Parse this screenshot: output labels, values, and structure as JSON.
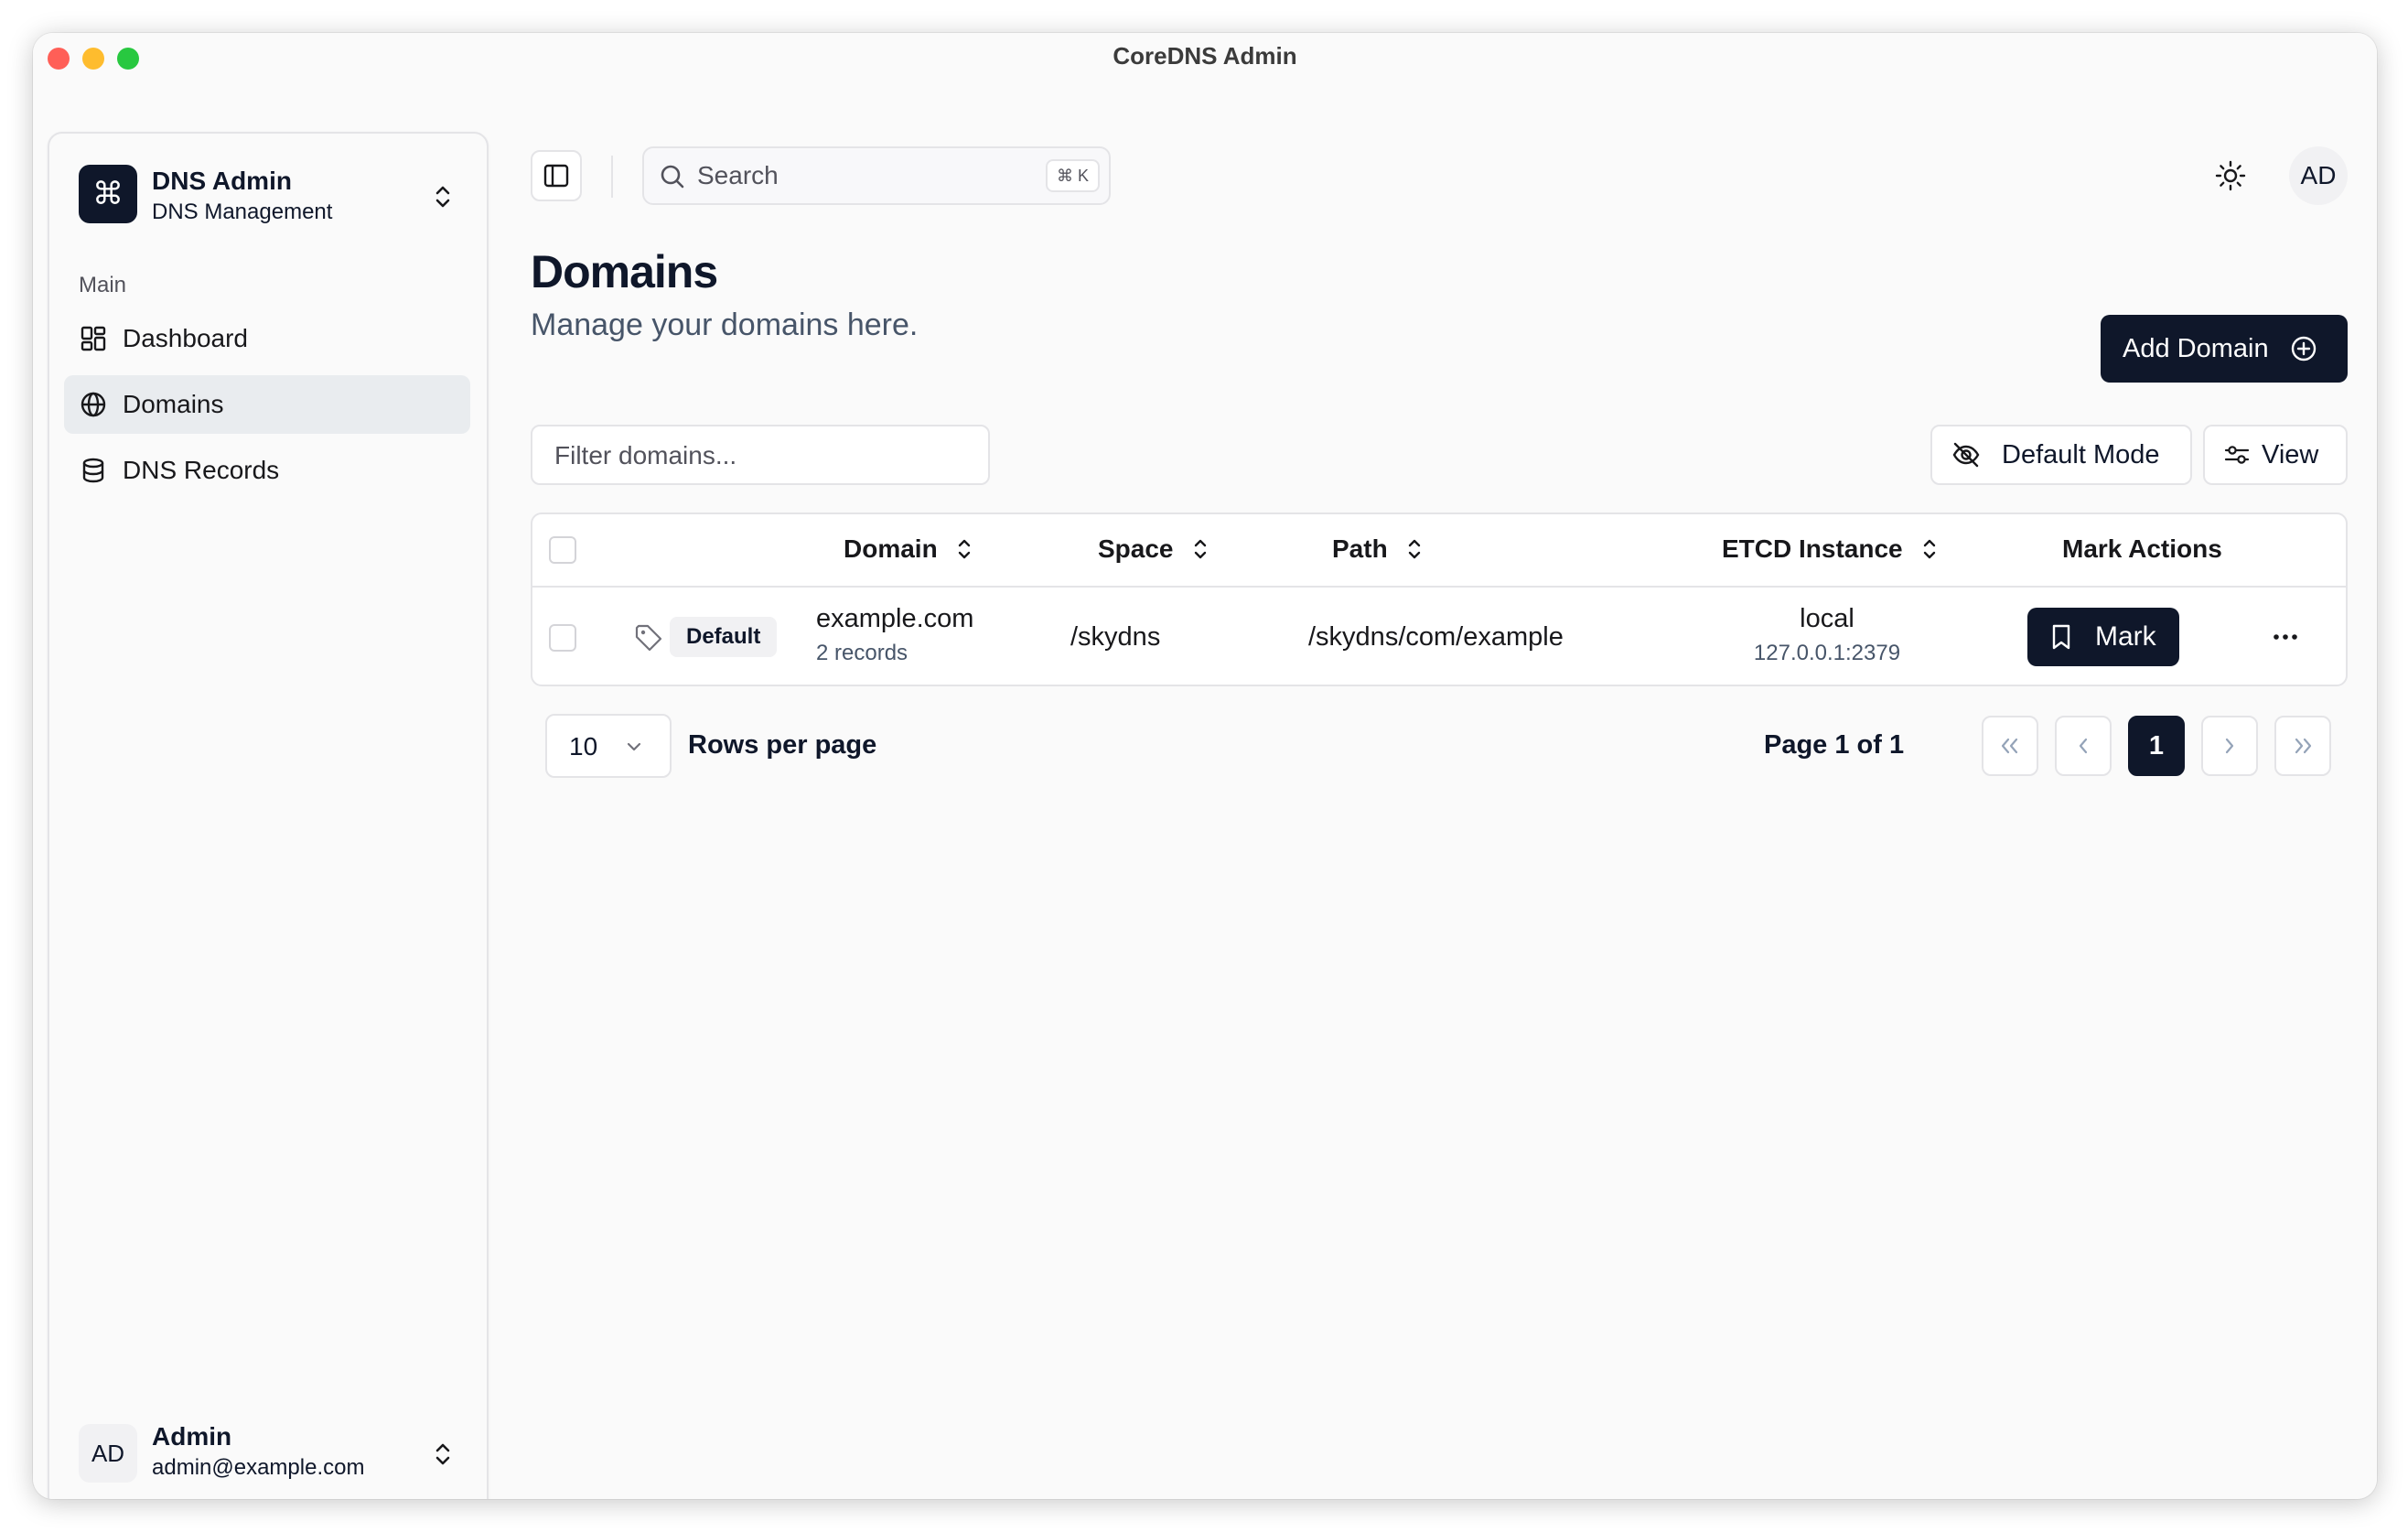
{
  "window": {
    "title": "CoreDNS Admin"
  },
  "sidebar": {
    "brand_name": "DNS Admin",
    "brand_subtitle": "DNS Management",
    "section_label": "Main",
    "items": [
      {
        "label": "Dashboard",
        "icon": "dashboard-icon",
        "active": false
      },
      {
        "label": "Domains",
        "icon": "globe-icon",
        "active": true
      },
      {
        "label": "DNS Records",
        "icon": "database-icon",
        "active": false
      }
    ],
    "user": {
      "initials": "AD",
      "name": "Admin",
      "email": "admin@example.com"
    }
  },
  "header": {
    "search_label": "Search",
    "search_shortcut": "⌘ K",
    "avatar_initials": "AD"
  },
  "page": {
    "title": "Domains",
    "subtitle": "Manage your domains here.",
    "add_button": "Add Domain",
    "filter_placeholder": "Filter domains...",
    "mode_button": "Default Mode",
    "view_button": "View"
  },
  "table": {
    "columns": [
      "Domain",
      "Space",
      "Path",
      "ETCD Instance",
      "Mark Actions"
    ],
    "rows": [
      {
        "tag": "Default",
        "domain": "example.com",
        "records": "2 records",
        "space": "/skydns",
        "path": "/skydns/com/example",
        "instance": "local",
        "instance_address": "127.0.0.1:2379",
        "mark_label": "Mark"
      }
    ]
  },
  "pagination": {
    "rows_per_page_value": "10",
    "rows_per_page_label": "Rows per page",
    "page_info": "Page 1 of 1",
    "current_page": "1"
  },
  "colors": {
    "primary": "#0f172a",
    "border": "#e4e4e7",
    "sidebar_active": "#e9ecef",
    "muted_text": "#475569"
  }
}
